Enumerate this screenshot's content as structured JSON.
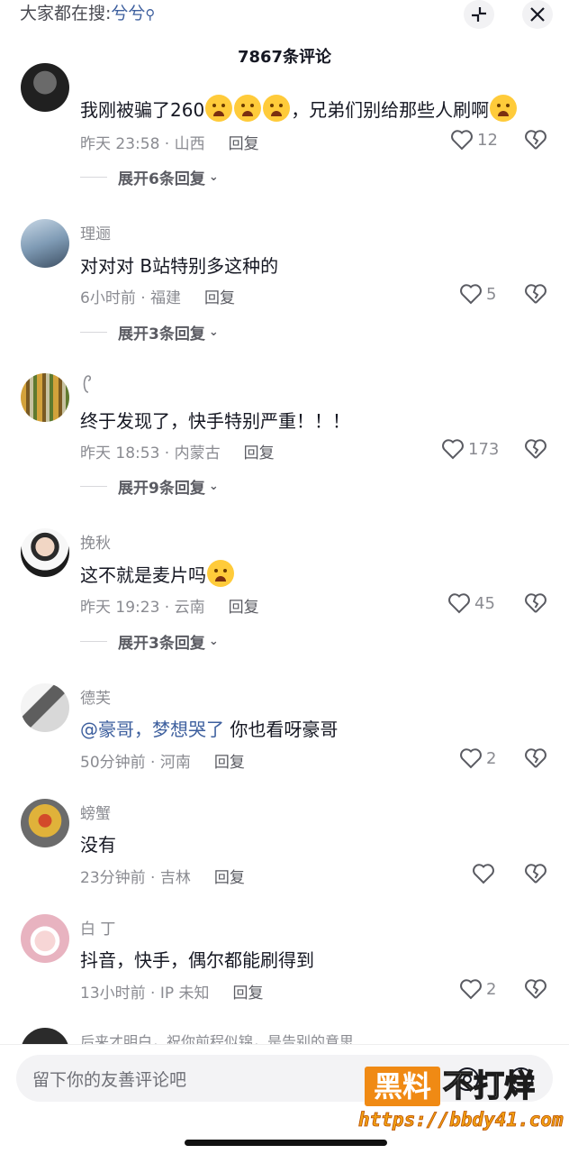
{
  "header": {
    "search_prefix": "大家都在搜:",
    "search_keyword": "兮兮",
    "comment_count_title": "7867条评论"
  },
  "comments": [
    {
      "username": "",
      "text_parts": [
        "我刚被骗了260",
        "，兄弟们别给那些人刷啊"
      ],
      "emoji_count_mid": 3,
      "time_location": "昨天 23:58 · 山西",
      "reply_label": "回复",
      "likes": "12",
      "expand_label": "展开6条回复"
    },
    {
      "username": "理逦",
      "text": "对对对 B站特别多这种的",
      "time_location": "6小时前 · 福建",
      "reply_label": "回复",
      "likes": "5",
      "expand_label": "展开3条回复"
    },
    {
      "username": "",
      "text": "终于发现了，快手特别严重！！！",
      "time_location": "昨天 18:53 · 内蒙古",
      "reply_label": "回复",
      "likes": "173",
      "expand_label": "展开9条回复"
    },
    {
      "username": "挽秋",
      "text": "这不就是麦片吗",
      "time_location": "昨天 19:23 · 云南",
      "reply_label": "回复",
      "likes": "45",
      "expand_label": "展开3条回复"
    },
    {
      "username": "德芙",
      "mention": "@豪哥，梦想哭了",
      "text": " 你也看呀豪哥",
      "time_location": "50分钟前 · 河南",
      "reply_label": "回复",
      "likes": "2"
    },
    {
      "username": "螃蟹",
      "text": "没有",
      "time_location": "23分钟前 · 吉林",
      "reply_label": "回复",
      "likes": ""
    },
    {
      "username": "白 丁",
      "text": "抖音，快手，偶尔都能刷得到",
      "time_location": "13小时前 · IP 未知",
      "reply_label": "回复",
      "likes": "2"
    },
    {
      "username": "后来才明白，祝你前程似锦，是告别的意思",
      "partial": true
    }
  ],
  "input": {
    "placeholder": "留下你的友善评论吧"
  },
  "watermark": {
    "box_text": "黑料",
    "text": "不打烊",
    "url": "https://bbdy41.com"
  },
  "icons": {
    "collapse": "collapse-icon",
    "close": "close-icon",
    "like": "heart-icon",
    "dislike": "broken-heart-icon"
  }
}
